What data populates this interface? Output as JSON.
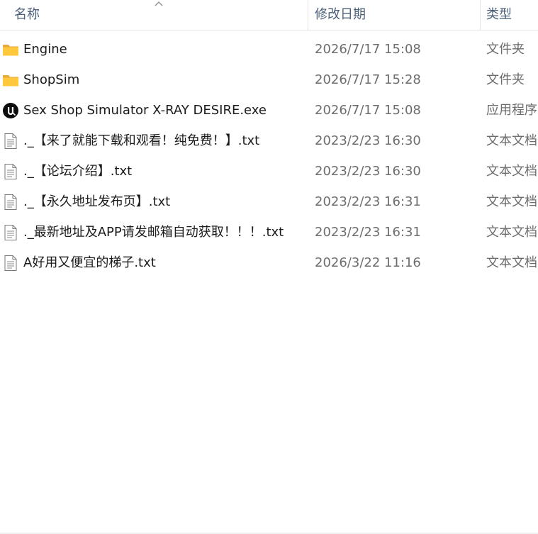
{
  "header": {
    "name": "名称",
    "date": "修改日期",
    "type": "类型"
  },
  "files": [
    {
      "name": "Engine",
      "date": "2026/7/17 15:08",
      "type": "文件夹",
      "icon": "folder-icon"
    },
    {
      "name": "ShopSim",
      "date": "2026/7/17 15:28",
      "type": "文件夹",
      "icon": "folder-icon"
    },
    {
      "name": "Sex Shop Simulator X-RAY DESIRE.exe",
      "date": "2026/7/17 15:08",
      "type": "应用程序",
      "icon": "unreal-app-icon"
    },
    {
      "name": "._【来了就能下载和观看！纯免费！】.txt",
      "date": "2023/2/23 16:30",
      "type": "文本文档",
      "icon": "text-file-icon"
    },
    {
      "name": "._【论坛介绍】.txt",
      "date": "2023/2/23 16:30",
      "type": "文本文档",
      "icon": "text-file-icon"
    },
    {
      "name": "._【永久地址发布页】.txt",
      "date": "2023/2/23 16:31",
      "type": "文本文档",
      "icon": "text-file-icon"
    },
    {
      "name": "._最新地址及APP请发邮箱自动获取！！！.txt",
      "date": "2023/2/23 16:31",
      "type": "文本文档",
      "icon": "text-file-icon"
    },
    {
      "name": "A好用又便宜的梯子.txt",
      "date": "2026/3/22 11:16",
      "type": "文本文档",
      "icon": "text-file-icon"
    }
  ],
  "colors": {
    "header_text": "#4c607a",
    "name_text": "#1b1b1b",
    "meta_text": "#6d6d6d",
    "folder": "#ffc83d"
  }
}
